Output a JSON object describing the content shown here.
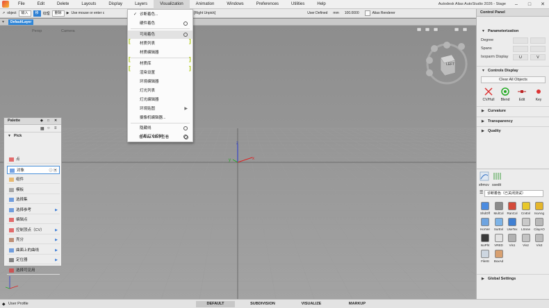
{
  "app": {
    "window_title": "Autodesk Alias AutoStudio 2026 - Stage",
    "menus": [
      "File",
      "Edit",
      "Delete",
      "Layouts",
      "Display",
      "Layers",
      "Visualization",
      "Animation",
      "Windows",
      "Preferences",
      "Utilities",
      "Help"
    ],
    "active_menu": "Visualization"
  },
  "toolbar": {
    "object_field": "object",
    "btn1": "输入",
    "btn2": "移",
    "field2": "纹理",
    "field3": "删除",
    "hint": "Use mouse or enter c",
    "hint_right": "Middle Add | [Right Unpick]",
    "units_label": "User Defined",
    "units": "mm",
    "scale": "100.0000",
    "renderer": "Alias Renderer"
  },
  "layer": {
    "name": "DefaultLayer"
  },
  "viewport": {
    "left_label": "Persp",
    "right_label": "Camera",
    "nav_label": "LEFT"
  },
  "dropdown": {
    "items": [
      {
        "label": "诊断着色...",
        "checked": true
      },
      {
        "label": "硬件着色",
        "opt": true
      },
      {
        "label": "可用着色",
        "opt": true,
        "highlight": true
      },
      {
        "label": "材质列表",
        "bracket": true
      },
      {
        "label": "材质编辑器"
      },
      {
        "label": "材质库",
        "bracket": true
      },
      {
        "label": "渲染设置",
        "bracket": true
      },
      {
        "label": "环境编辑器"
      },
      {
        "label": "灯光列表"
      },
      {
        "label": "灯光编辑器"
      },
      {
        "label": "环境贴图",
        "arrow": true
      },
      {
        "label": "摄像机编辑器..."
      },
      {
        "label": "隐藏线",
        "opt": true
      },
      {
        "label": "诊断灯光控制",
        "opt": true
      },
      {
        "label": "在Alias VR中查看",
        "opt": true
      }
    ]
  },
  "palette": {
    "title": "Palette",
    "section": "Pick",
    "rows": [
      {
        "label": "点",
        "arrow": false
      },
      {
        "label": "对象",
        "arrow": false,
        "selected": true
      },
      {
        "label": "组件",
        "arrow": false
      },
      {
        "label": "模板",
        "arrow": false
      },
      {
        "label": "选择集",
        "arrow": false
      },
      {
        "label": "选择参考",
        "arrow": true
      },
      {
        "label": "编辑点",
        "arrow": false
      },
      {
        "label": "控制顶点（CV）",
        "arrow": true
      },
      {
        "label": "壳分",
        "arrow": true
      },
      {
        "label": "曲面上的曲线",
        "arrow": true
      },
      {
        "label": "定位器",
        "arrow": true
      },
      {
        "label": "选择可见用",
        "arrow": false
      }
    ]
  },
  "control_panel": {
    "title": "Control Panel",
    "parameterization": {
      "title": "Parameterization",
      "degree_label": "Degree",
      "spans_label": "Spans",
      "isoparm_label": "Isoparm Display",
      "u": "U",
      "v": "V"
    },
    "controls_display": {
      "title": "Controls Display",
      "clear_all": "Clear All Objects",
      "buttons": [
        "CV/Hull",
        "Blend",
        "Edit",
        "Key"
      ]
    },
    "sections": [
      "Curvature",
      "Transparency",
      "Quality"
    ],
    "global_settings": "Global Settings"
  },
  "shelf": {
    "tabs": [
      "sfrmcv",
      "ssedit"
    ],
    "selector": "诊断着色（已关闭测试）",
    "items": [
      {
        "label": "ShdOff",
        "color": "#4a8be0"
      },
      {
        "label": "MulCol",
        "color": "#8b8b8b"
      },
      {
        "label": "RanCol",
        "color": "#d44a3a"
      },
      {
        "label": "CrvEvl",
        "color": "#e8c82a"
      },
      {
        "label": "IsoAng",
        "color": "#e5b62b"
      },
      {
        "label": "HorVer",
        "color": "#6ea4e0"
      },
      {
        "label": "SurEvl",
        "color": "#7db3e6"
      },
      {
        "label": "UseTex",
        "color": "#3f7fd2"
      },
      {
        "label": "LSnne",
        "color": "#c9c9c9"
      },
      {
        "label": "ClayAO",
        "color": "#b8b8b8"
      },
      {
        "label": "IsoPht",
        "color": "#3a3a3a"
      },
      {
        "label": "VRED",
        "color": "#e2e2e2"
      },
      {
        "label": "Vis1",
        "color": "#b1b1b1"
      },
      {
        "label": "Vis2",
        "color": "#c4c4c4"
      },
      {
        "label": "Vis3",
        "color": "#bdbdbd"
      },
      {
        "label": "FileSt",
        "color": "#cdd6e0"
      },
      {
        "label": "BoxAd",
        "color": "#d8a070"
      }
    ]
  },
  "status": {
    "profile": "User Profile",
    "tabs": [
      "DEFAULT",
      "SUBDIVISION",
      "VISUALIZE",
      "MARKUP"
    ],
    "active_tab": "DEFAULT"
  },
  "colors": {
    "accent_blue": "#2d7fd3",
    "bracket_green": "#a8c500",
    "axis_x": "#d22",
    "axis_y": "#2a2",
    "axis_z": "#23c"
  }
}
